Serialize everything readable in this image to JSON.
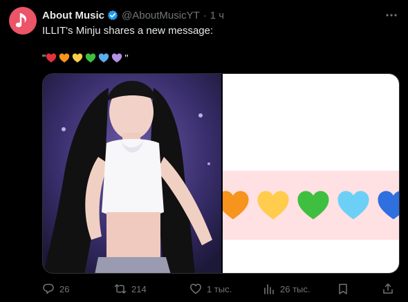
{
  "author": {
    "name": "About Music",
    "handle": "@AboutMusicYT",
    "separator": "·",
    "time": "1 ч"
  },
  "post": {
    "text": "ILLIT's Minju shares a new message:",
    "quote_open": "\"",
    "quote_close": "\"",
    "hearts": [
      "red-heart-icon",
      "orange-heart-icon",
      "yellow-heart-icon",
      "green-heart-icon",
      "blue-heart-icon",
      "purple-heart-icon"
    ]
  },
  "media": {
    "panel_hearts": [
      "orange-heart-icon",
      "yellow-heart-icon",
      "green-heart-icon",
      "light-blue-heart-icon",
      "blue-heart-icon"
    ]
  },
  "colors": {
    "avatar_bg": "#ec5468",
    "verified": "#1d9bf0",
    "red": "#e0323c",
    "orange": "#f7941d",
    "yellow": "#ffcc4d",
    "green": "#3fbf3f",
    "light_blue": "#6cd0f6",
    "blue": "#2f6fe0",
    "purple": "#b392e6",
    "band": "#ffe0e3"
  },
  "actions": {
    "replies": "26",
    "reposts": "214",
    "likes": "1 тыс.",
    "views": "26 тыс."
  }
}
